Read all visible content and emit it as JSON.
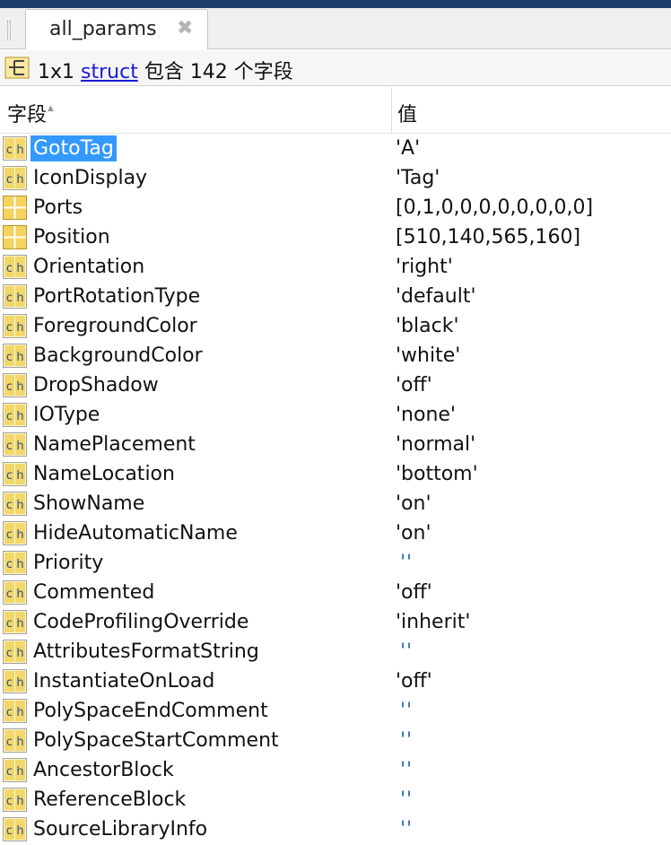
{
  "tab": {
    "label": "all_params",
    "close_glyph": "✖"
  },
  "info": {
    "prefix": "1x1 ",
    "link": "struct",
    "suffix": " 包含 142 个字段",
    "icon": "struct-icon"
  },
  "table": {
    "headers": {
      "field": "字段",
      "value": "值"
    },
    "sort_glyph": "▲",
    "colors": {
      "char_icon": "#f2d76a",
      "matrix_icon": "#f4d35e",
      "selected": "#3399ff",
      "empty_value": "#2f6fbf"
    },
    "rows": [
      {
        "name": "GotoTag",
        "value": "'A'",
        "icon": "char-icon",
        "selected": true
      },
      {
        "name": "IconDisplay",
        "value": "'Tag'",
        "icon": "char-icon"
      },
      {
        "name": "Ports",
        "value": "[0,1,0,0,0,0,0,0,0,0]",
        "icon": "matrix-icon"
      },
      {
        "name": "Position",
        "value": "[510,140,565,160]",
        "icon": "matrix-icon"
      },
      {
        "name": "Orientation",
        "value": "'right'",
        "icon": "char-icon"
      },
      {
        "name": "PortRotationType",
        "value": "'default'",
        "icon": "char-icon"
      },
      {
        "name": "ForegroundColor",
        "value": "'black'",
        "icon": "char-icon"
      },
      {
        "name": "BackgroundColor",
        "value": "'white'",
        "icon": "char-icon"
      },
      {
        "name": "DropShadow",
        "value": "'off'",
        "icon": "char-icon"
      },
      {
        "name": "IOType",
        "value": "'none'",
        "icon": "char-icon"
      },
      {
        "name": "NamePlacement",
        "value": "'normal'",
        "icon": "char-icon"
      },
      {
        "name": "NameLocation",
        "value": "'bottom'",
        "icon": "char-icon"
      },
      {
        "name": "ShowName",
        "value": "'on'",
        "icon": "char-icon"
      },
      {
        "name": "HideAutomaticName",
        "value": "'on'",
        "icon": "char-icon"
      },
      {
        "name": "Priority",
        "value": "''",
        "icon": "char-icon",
        "empty": true
      },
      {
        "name": "Commented",
        "value": "'off'",
        "icon": "char-icon"
      },
      {
        "name": "CodeProfilingOverride",
        "value": "'inherit'",
        "icon": "char-icon"
      },
      {
        "name": "AttributesFormatString",
        "value": "''",
        "icon": "char-icon",
        "empty": true
      },
      {
        "name": "InstantiateOnLoad",
        "value": "'off'",
        "icon": "char-icon"
      },
      {
        "name": "PolySpaceEndComment",
        "value": "''",
        "icon": "char-icon",
        "empty": true
      },
      {
        "name": "PolySpaceStartComment",
        "value": "''",
        "icon": "char-icon",
        "empty": true
      },
      {
        "name": "AncestorBlock",
        "value": "''",
        "icon": "char-icon",
        "empty": true
      },
      {
        "name": "ReferenceBlock",
        "value": "''",
        "icon": "char-icon",
        "empty": true
      },
      {
        "name": "SourceLibraryInfo",
        "value": "''",
        "icon": "char-icon",
        "empty": true
      }
    ]
  }
}
